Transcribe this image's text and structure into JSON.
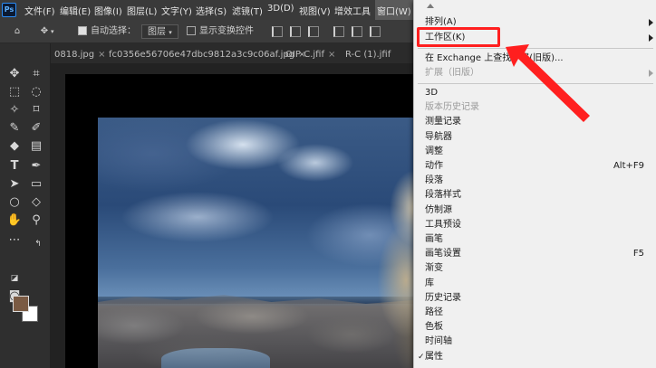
{
  "menubar": {
    "logo": "Ps",
    "items": [
      "文件(F)",
      "编辑(E)",
      "图像(I)",
      "图层(L)",
      "文字(Y)",
      "选择(S)",
      "滤镜(T)",
      "3D(D)",
      "视图(V)",
      "增效工具",
      "窗口(W)"
    ]
  },
  "options": {
    "auto_select_label": "自动选择：",
    "auto_select_checked": true,
    "layer_select_value": "图层",
    "show_transform_label": "显示变换控件",
    "show_transform_checked": false
  },
  "tabs": [
    {
      "label": "0818.jpg",
      "close": "×"
    },
    {
      "label": "fc0356e56706e47dbc9812a3c9c06af.jpg",
      "close": "×"
    },
    {
      "label": "OIP-C.jfif",
      "close": "×"
    },
    {
      "label": "R-C (1).jfif",
      "close": "×"
    }
  ],
  "toolbox": {
    "foreground_color": "#7a5a43",
    "background_color": "#ffffff"
  },
  "window_menu": {
    "items": [
      {
        "label": "排列(A)",
        "submenu": true
      },
      {
        "label": "工作区(K)",
        "submenu": true,
        "highlighted_annotation": true
      },
      {
        "label": "在 Exchange 上查找扩展(旧版)..."
      },
      {
        "label": "扩展（旧版）",
        "submenu": true,
        "disabled": true
      },
      {
        "label": "3D"
      },
      {
        "label": "版本历史记录",
        "disabled": true
      },
      {
        "label": "测量记录"
      },
      {
        "label": "导航器"
      },
      {
        "label": "调整"
      },
      {
        "label": "动作",
        "shortcut": "Alt+F9"
      },
      {
        "label": "段落"
      },
      {
        "label": "段落样式"
      },
      {
        "label": "仿制源"
      },
      {
        "label": "工具预设"
      },
      {
        "label": "画笔"
      },
      {
        "label": "画笔设置",
        "shortcut": "F5"
      },
      {
        "label": "渐变"
      },
      {
        "label": "库"
      },
      {
        "label": "历史记录"
      },
      {
        "label": "路径"
      },
      {
        "label": "色板"
      },
      {
        "label": "时间轴"
      },
      {
        "label": "属性",
        "checked": true
      }
    ]
  },
  "annotation": {
    "color": "#ff1f1f"
  }
}
